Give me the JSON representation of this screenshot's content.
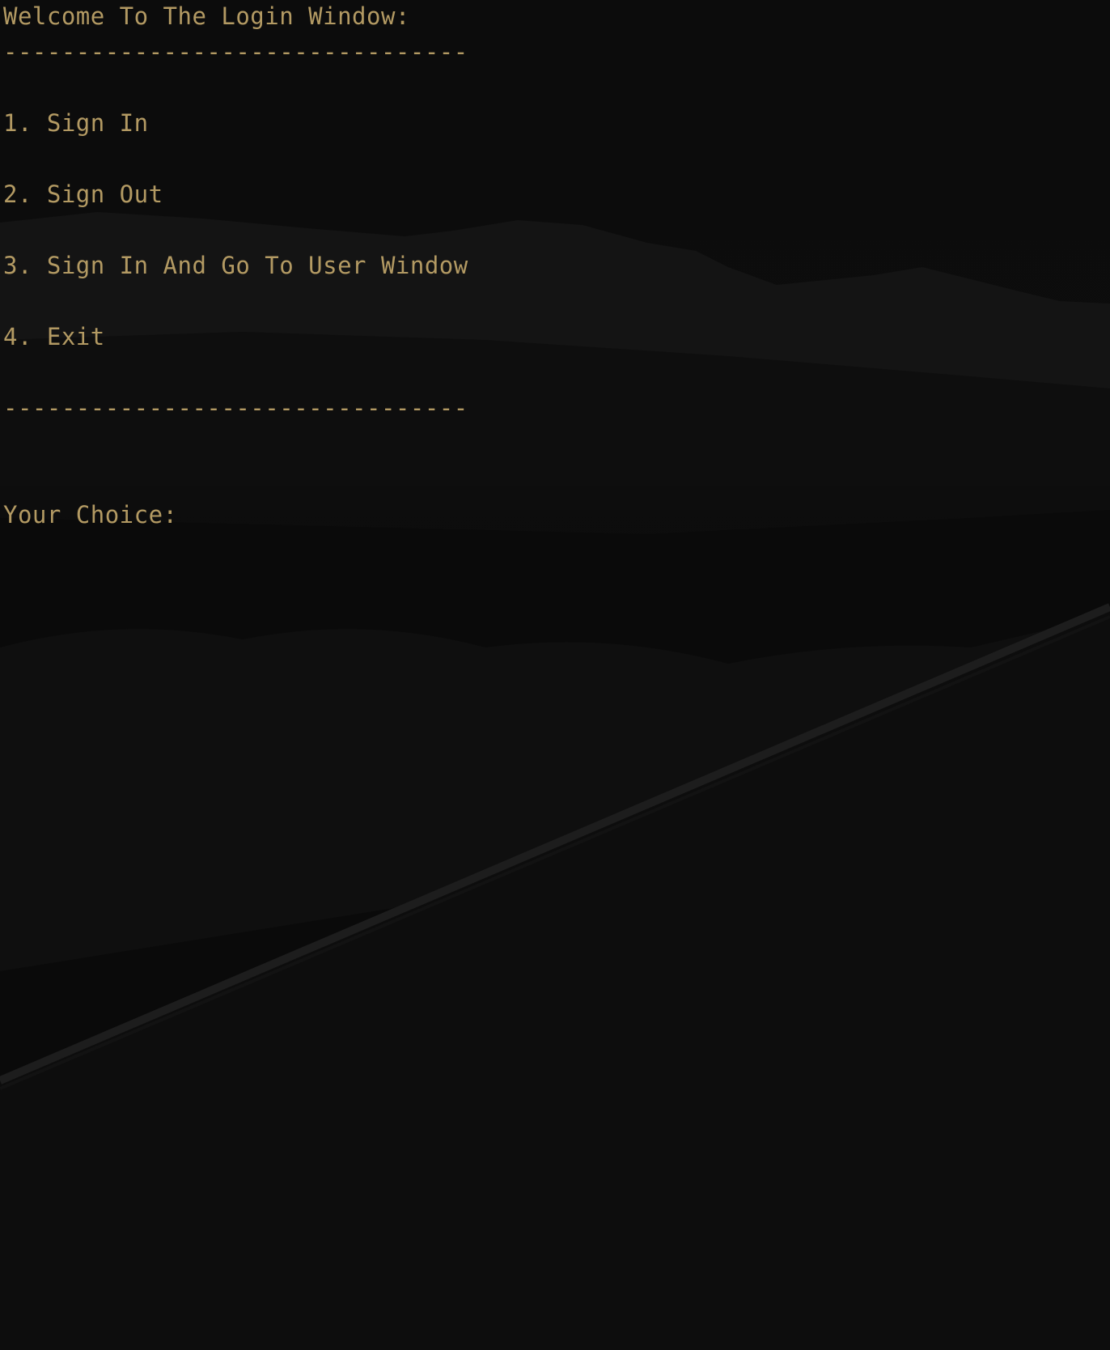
{
  "colors": {
    "background": "#0b0b0b",
    "text": "#b39a63"
  },
  "terminal": {
    "title_line": "Welcome To The Login Window:",
    "separator_top": "--------------------------------",
    "menu_items": [
      "1. Sign In",
      "2. Sign Out",
      "3. Sign In And Go To User Window",
      "4. Exit"
    ],
    "separator_bottom": "--------------------------------",
    "prompt": "Your Choice:",
    "input_value": ""
  }
}
